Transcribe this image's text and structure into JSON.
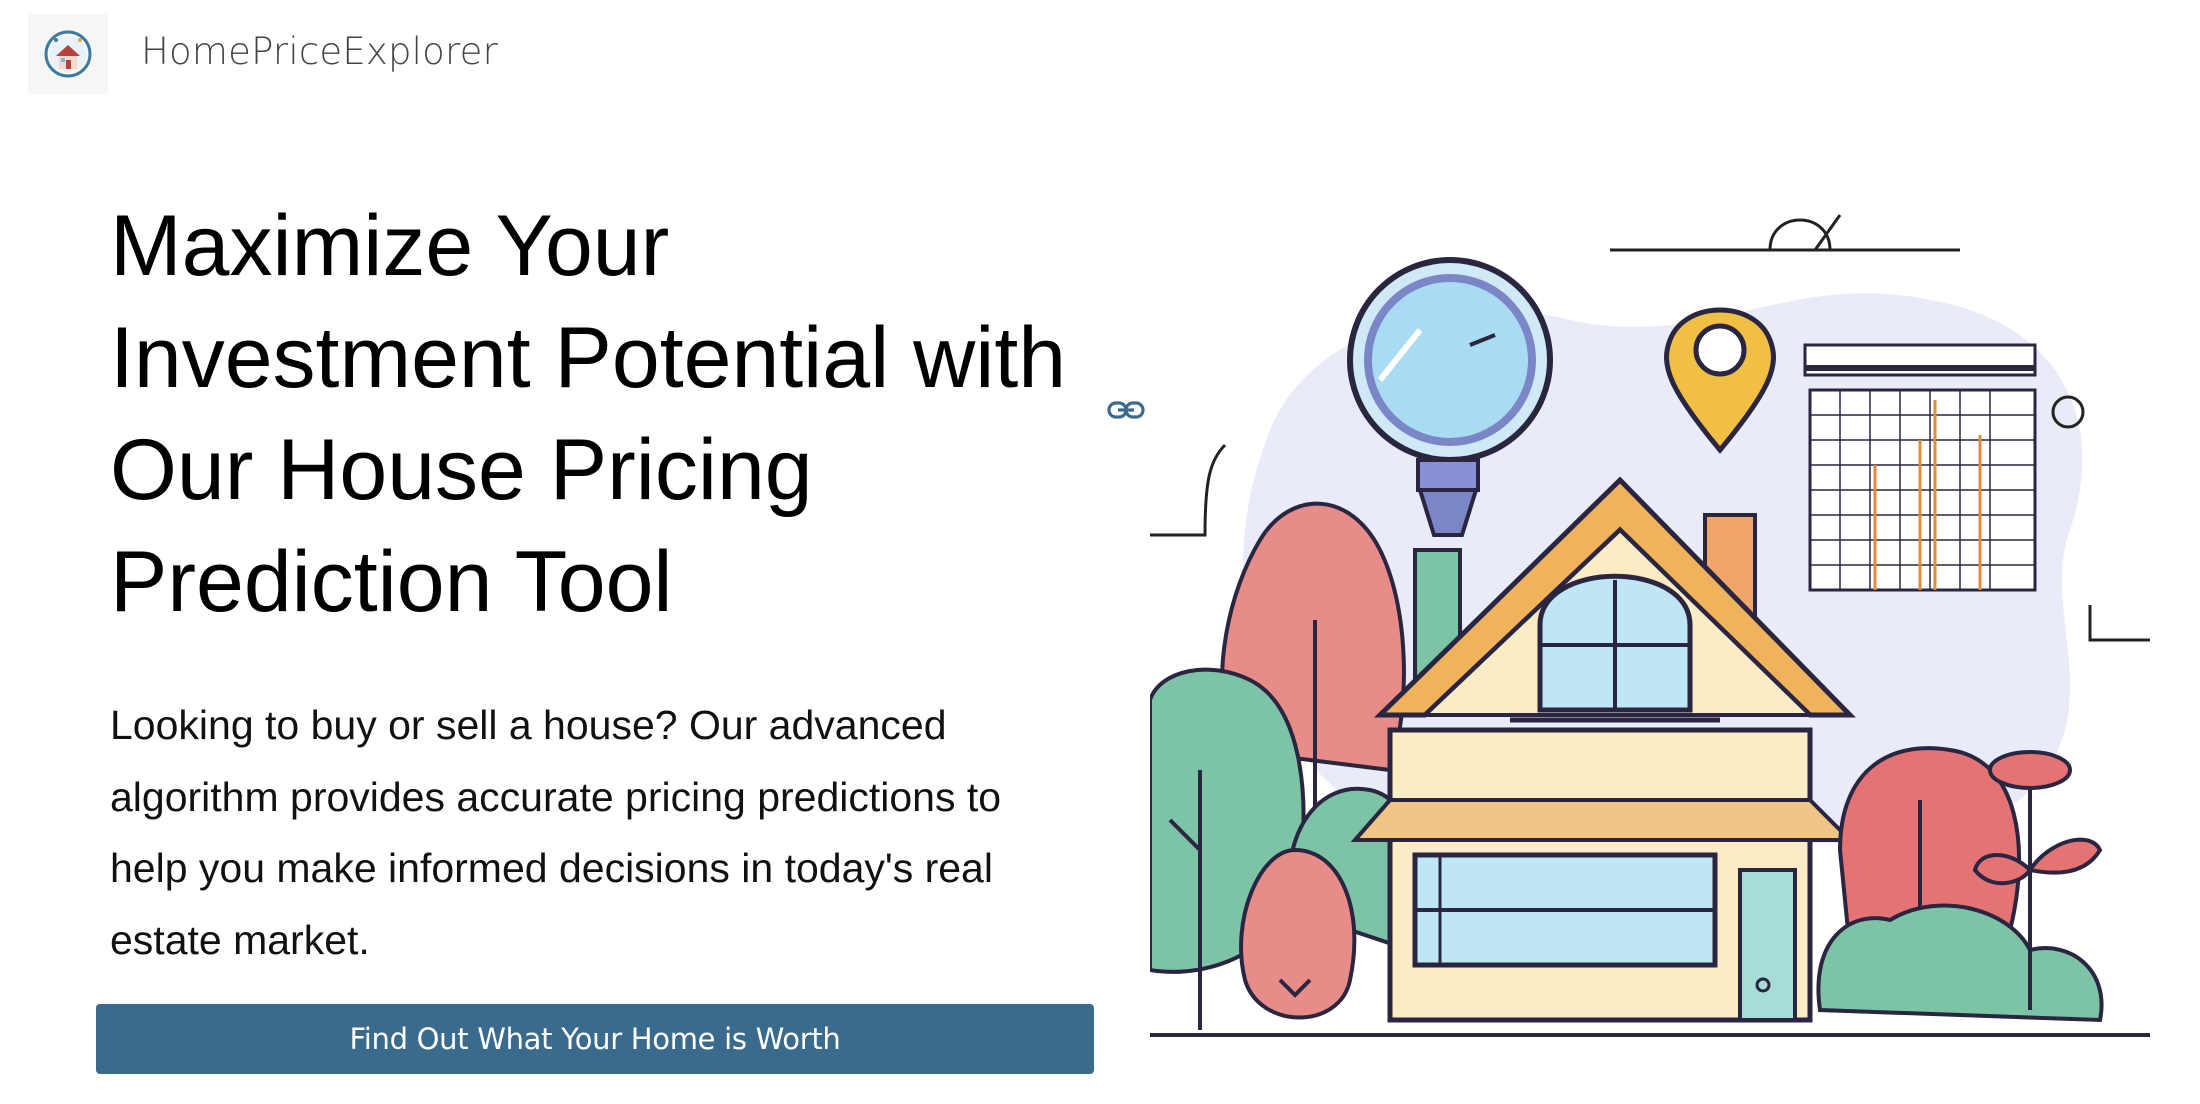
{
  "header": {
    "brand": "HomePriceExplorer",
    "logo_icon": "house-magnifier-logo-icon"
  },
  "hero": {
    "headline": "Maximize Your Investment Potential with Our House Pricing Prediction Tool",
    "description": "Looking to buy or sell a house? Our advanced algorithm provides accurate pricing predictions to help you make informed decisions in today's real estate market.",
    "cta_label": "Find Out What Your Home is Worth",
    "anchor_icon": "link-icon",
    "illustration": "house-illustration"
  },
  "colors": {
    "cta": "#3a6b8d",
    "brand_text": "#444444",
    "roof": "#f0b35c",
    "tree_red": "#e57373",
    "tree_green": "#7dc3a5"
  }
}
